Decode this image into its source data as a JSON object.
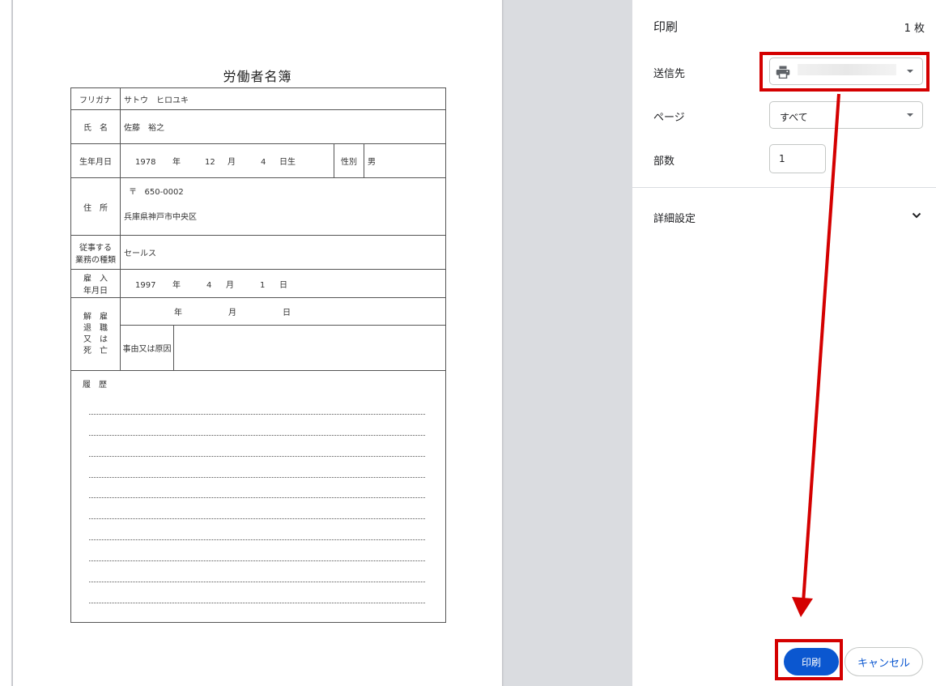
{
  "form": {
    "title": "労働者名簿",
    "furigana_label": "フリガナ",
    "furigana_value": "サトウ　ヒロユキ",
    "name_label": "氏　名",
    "name_value": "佐藤　裕之",
    "birth_label": "生年月日",
    "birth_year": "1978",
    "birth_month": "12",
    "birth_day": "4",
    "year_unit": "年",
    "month_unit": "月",
    "day_unit": "日",
    "birth_suffix": "日生",
    "gender_label": "性別",
    "gender_value": "男",
    "address_label": "住　所",
    "address_zip_mark": "〒",
    "address_zip": "650-0002",
    "address_value": "兵庫県神戸市中央区",
    "job_label_1": "従事する",
    "job_label_2": "業務の種類",
    "job_value": "セールス",
    "hire_label_1": "雇　入",
    "hire_label_2": "年月日",
    "hire_year": "1997",
    "hire_month": "4",
    "hire_day": "1",
    "retire_label_1": "解　雇",
    "retire_label_2": "退　職",
    "retire_label_3": "又　は",
    "retire_label_4": "死　亡",
    "reason_label": "事由又は原因",
    "history_label": "履　歴"
  },
  "print_panel": {
    "title": "印刷",
    "sheet_count": "1 枚",
    "destination_label": "送信先",
    "pages_label": "ページ",
    "pages_value": "すべて",
    "copies_label": "部数",
    "copies_value": "1",
    "more_settings_label": "詳細設定",
    "print_button_label": "印刷",
    "cancel_button_label": "キャンセル"
  },
  "icons": {
    "printer": "printer-icon",
    "dropdown": "caret-down-icon",
    "chevron": "chevron-down-icon"
  },
  "colors": {
    "accent_blue": "#0b57d0",
    "annotation_red": "#d40000",
    "preview_background": "#dadce0"
  }
}
